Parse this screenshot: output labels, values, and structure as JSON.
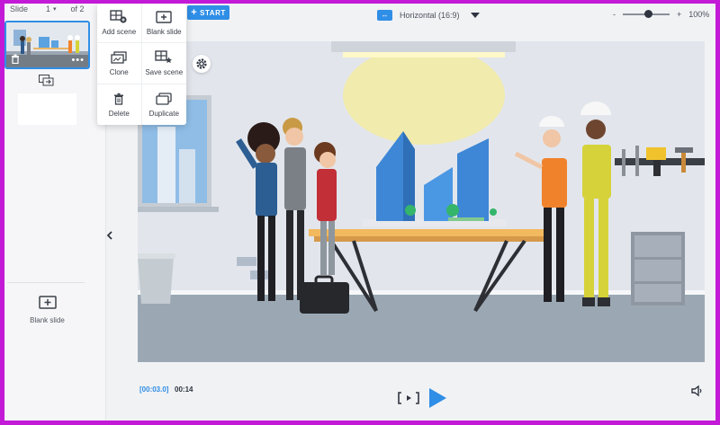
{
  "sidebar": {
    "slide_label": "Slide",
    "slide_current": "1",
    "slide_of": "of 2",
    "blank_slide_label": "Blank slide"
  },
  "menu": {
    "items": [
      {
        "label": "Add scene",
        "icon": "add-scene-icon"
      },
      {
        "label": "Blank slide",
        "icon": "blank-slide-icon"
      },
      {
        "label": "Clone",
        "icon": "clone-icon"
      },
      {
        "label": "Save scene",
        "icon": "save-scene-icon"
      },
      {
        "label": "Delete",
        "icon": "trash-icon"
      },
      {
        "label": "Duplicate",
        "icon": "duplicate-icon"
      }
    ]
  },
  "toolbar": {
    "start_label": "START",
    "orientation_label": "Horizontal (16:9)",
    "zoom_minus": "-",
    "zoom_plus": "+",
    "zoom_value": "100%",
    "zoom_level": 0.55
  },
  "timeline": {
    "current_time": "[00:03.0]",
    "total_time": "00:14"
  },
  "colors": {
    "accent": "#2f8ee6",
    "border": "#c21ad6"
  }
}
